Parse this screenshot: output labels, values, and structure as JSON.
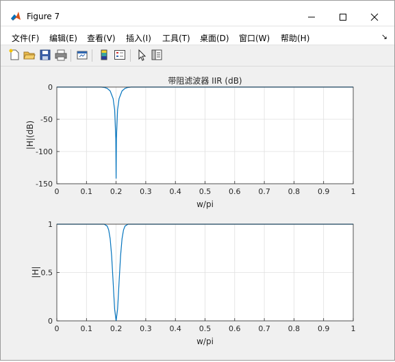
{
  "window": {
    "title": "Figure 7"
  },
  "menu": {
    "items": [
      "文件(F)",
      "编辑(E)",
      "查看(V)",
      "插入(I)",
      "工具(T)",
      "桌面(D)",
      "窗口(W)",
      "帮助(H)"
    ]
  },
  "toolbar": {
    "buttons": [
      "new-figure",
      "open-file",
      "save",
      "print",
      "link-plot",
      "insert-colorbar",
      "insert-legend",
      "edit-plot",
      "property-inspector"
    ]
  },
  "colors": {
    "line": "#0072bd",
    "grid": "#dfdfdf",
    "axes_bg": "#ffffff",
    "window_bg": "#f0f0f0"
  },
  "chart_data": [
    {
      "type": "line",
      "title": "带阻滤波器 IIR (dB)",
      "xlabel": "w/pi",
      "ylabel": "|H|(dB)",
      "xlim": [
        0,
        1
      ],
      "ylim": [
        -150,
        0
      ],
      "xticks": [
        "0",
        "0.1",
        "0.2",
        "0.3",
        "0.4",
        "0.5",
        "0.6",
        "0.7",
        "0.8",
        "0.9",
        "1"
      ],
      "yticks": [
        "0",
        "-50",
        "-100",
        "-150"
      ],
      "grid": true,
      "series": [
        {
          "x": [
            0,
            0.15,
            0.16,
            0.17,
            0.18,
            0.19,
            0.195,
            0.199,
            0.2,
            0.201,
            0.205,
            0.21,
            0.22,
            0.23,
            0.24,
            0.25,
            1
          ],
          "y": [
            0,
            0,
            -0.5,
            -2,
            -6,
            -18,
            -35,
            -80,
            -142,
            -80,
            -35,
            -18,
            -6,
            -2,
            -0.5,
            0,
            0
          ]
        }
      ]
    },
    {
      "type": "line",
      "title": "",
      "xlabel": "w/pi",
      "ylabel": "|H|",
      "xlim": [
        0,
        1
      ],
      "ylim": [
        0,
        1
      ],
      "xticks": [
        "0",
        "0.1",
        "0.2",
        "0.3",
        "0.4",
        "0.5",
        "0.6",
        "0.7",
        "0.8",
        "0.9",
        "1"
      ],
      "yticks": [
        "1",
        "0.5",
        "0"
      ],
      "grid": true,
      "series": [
        {
          "x": [
            0,
            0.16,
            0.17,
            0.175,
            0.18,
            0.185,
            0.19,
            0.195,
            0.2,
            0.205,
            0.21,
            0.215,
            0.22,
            0.225,
            0.23,
            0.24,
            1
          ],
          "y": [
            1,
            1,
            0.98,
            0.94,
            0.85,
            0.67,
            0.4,
            0.12,
            0,
            0.12,
            0.4,
            0.67,
            0.85,
            0.94,
            0.98,
            1,
            1
          ]
        }
      ]
    }
  ]
}
